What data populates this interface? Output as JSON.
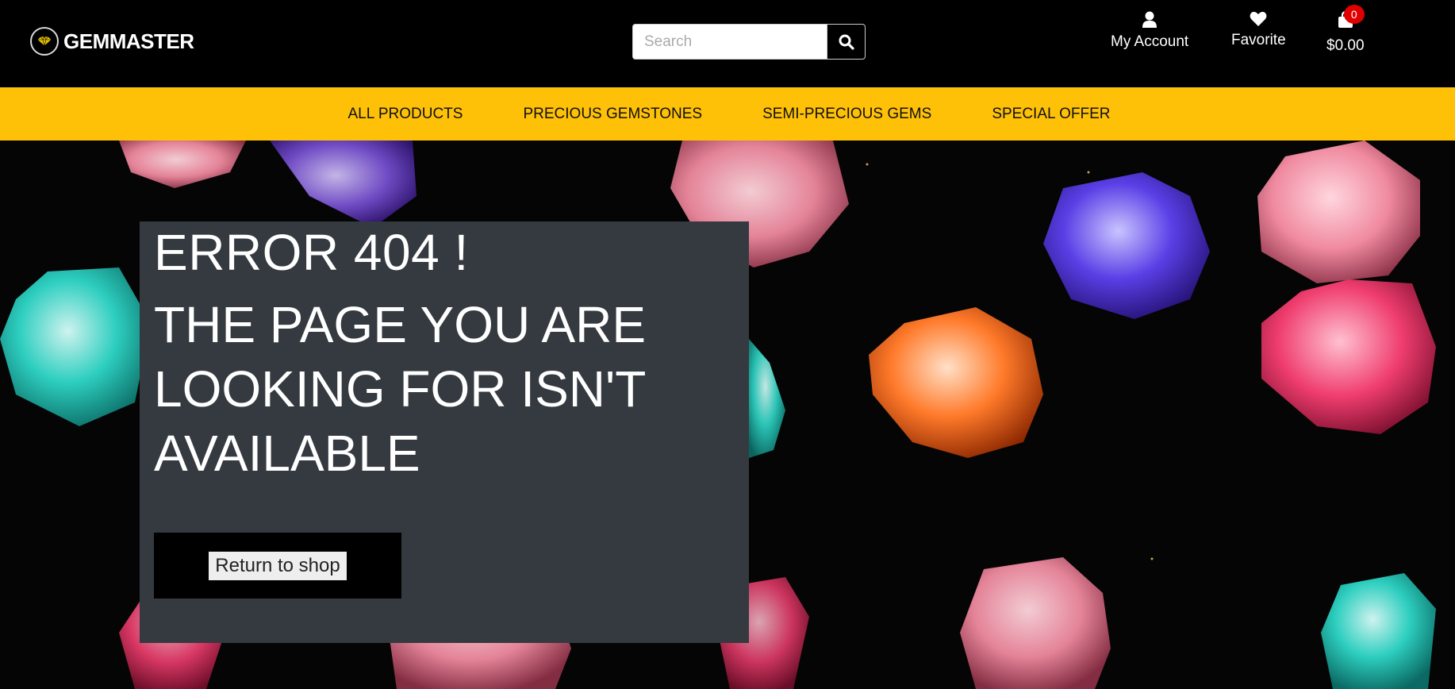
{
  "brand": {
    "name": "GEMMASTER",
    "logo_icon": "gem-logo-icon"
  },
  "search": {
    "placeholder": "Search",
    "value": "",
    "icon": "search-icon"
  },
  "account": {
    "label": "My Account",
    "icon": "user-icon"
  },
  "favorite": {
    "label": "Favorite",
    "icon": "heart-icon"
  },
  "cart": {
    "total": "$0.00",
    "count": "0",
    "icon": "shopping-bag-icon"
  },
  "nav": {
    "items": [
      {
        "label": "ALL PRODUCTS"
      },
      {
        "label": "PRECIOUS GEMSTONES"
      },
      {
        "label": "SEMI-PRECIOUS GEMS"
      },
      {
        "label": "SPECIAL OFFER"
      }
    ]
  },
  "error": {
    "code": "ERROR 404 !",
    "message": "THE PAGE YOU ARE LOOKING FOR ISN'T AVAILABLE",
    "button_label": "Return to shop"
  },
  "colors": {
    "nav_bg": "#ffc107",
    "header_bg": "#000000",
    "panel_bg": "#343a40",
    "badge_bg": "#e00000"
  }
}
